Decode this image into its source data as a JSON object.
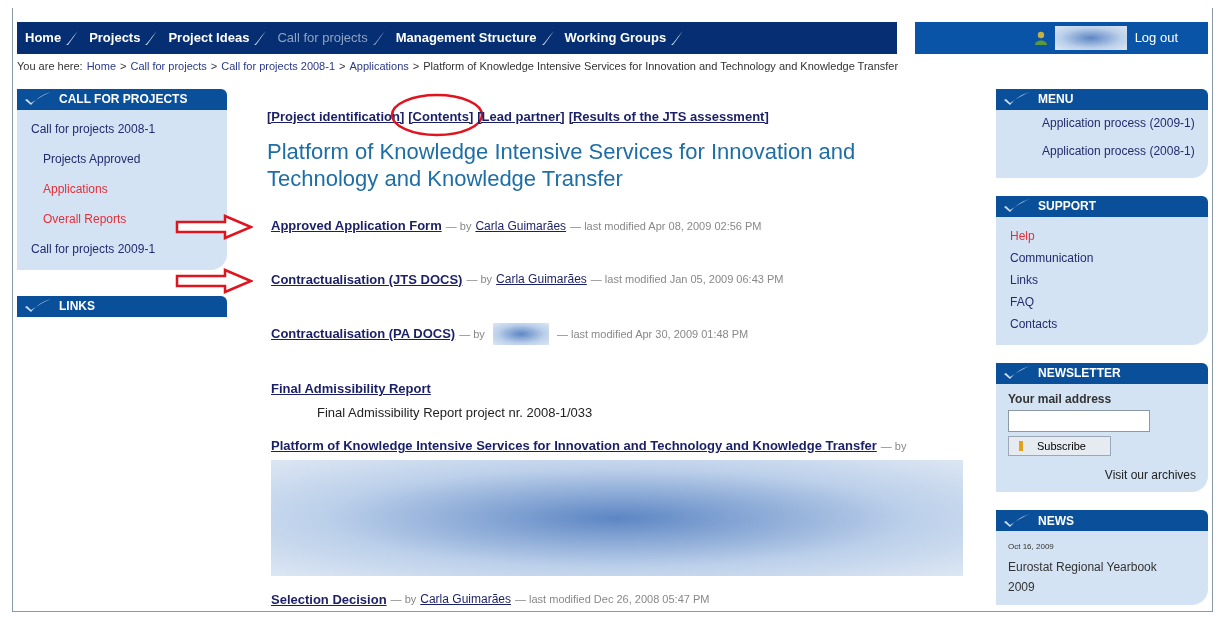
{
  "nav": {
    "items": [
      {
        "label": "Home",
        "selected": false
      },
      {
        "label": "Projects",
        "selected": false
      },
      {
        "label": "Project Ideas",
        "selected": false
      },
      {
        "label": "Call for projects",
        "selected": true
      },
      {
        "label": "Management Structure",
        "selected": false
      },
      {
        "label": "Working Groups",
        "selected": false
      }
    ],
    "logout": "Log out"
  },
  "breadcrumb": [
    {
      "kind": "text",
      "label": "You are here:"
    },
    {
      "kind": "link",
      "label": "Home"
    },
    {
      "kind": "separator",
      "label": ">"
    },
    {
      "kind": "link",
      "label": "Call for projects"
    },
    {
      "kind": "separator",
      "label": ">"
    },
    {
      "kind": "link",
      "label": "Call for projects 2008-1"
    },
    {
      "kind": "separator",
      "label": ">"
    },
    {
      "kind": "link",
      "label": "Applications"
    },
    {
      "kind": "separator",
      "label": ">"
    },
    {
      "kind": "text",
      "label": "Platform of Knowledge Intensive Services for Innovation and Technology and Knowledge Transfer"
    }
  ],
  "left_sidebar": [
    {
      "title": "CALL FOR PROJECTS",
      "items": [
        {
          "label": "Call for projects 2008-1",
          "selected": false,
          "children": [
            {
              "label": "Projects Approved",
              "selected": false
            },
            {
              "label": "Applications",
              "selected": true
            },
            {
              "label": "Overall Reports",
              "selected": true
            }
          ]
        },
        {
          "label": "Call for projects 2009-1",
          "selected": false
        }
      ]
    },
    {
      "title": "LINKS"
    }
  ],
  "tabs": [
    {
      "label": "[Project identification]",
      "circled": false
    },
    {
      "label": "[Contents]",
      "circled": true
    },
    {
      "label": "[Lead partner]",
      "circled": false
    },
    {
      "label": "[Results of the JTS assessment]",
      "circled": false
    }
  ],
  "heading": "Platform of Knowledge Intensive Services for Innovation and Technology and Knowledge Transfer",
  "documents": [
    {
      "kind": "meta",
      "title": "Approved Application Form",
      "by": "— by",
      "author": "Carla Guimarães",
      "modified": "— last modified Apr 08, 2009 02:56 PM",
      "arrow": true
    },
    {
      "kind": "meta",
      "title": "Contractualisation (JTS DOCS)",
      "by": "— by",
      "author": "Carla Guimarães",
      "modified": "— last modified Jan 05, 2009 06:43 PM",
      "arrow": true
    },
    {
      "kind": "redacted_author",
      "title": "Contractualisation (PA DOCS)",
      "by": "— by",
      "modified": "— last modified Apr 30, 2009 01:48 PM",
      "arrow": false
    },
    {
      "kind": "description",
      "title": "Final Admissibility Report",
      "description": "Final Admissibility Report project nr. 2008-1/033",
      "arrow": false
    },
    {
      "kind": "redacted_block",
      "title": "Platform of Knowledge Intensive Services for Innovation and Technology and Knowledge Transfer",
      "by": "— by",
      "arrow": false
    },
    {
      "kind": "meta",
      "title": "Selection Decision",
      "by": "— by",
      "author": "Carla Guimarães",
      "modified": "— last modified Dec 26, 2008 05:47 PM",
      "arrow": false
    }
  ],
  "right_sidebar": [
    {
      "kind": "links",
      "title": "MENU",
      "indent": true,
      "items": [
        {
          "label": "Application process (2009-1)",
          "selected": false
        },
        {
          "label": "Application process (2008-1)",
          "selected": false
        }
      ]
    },
    {
      "kind": "links",
      "title": "SUPPORT",
      "indent": false,
      "items": [
        {
          "label": "Help",
          "selected": true
        },
        {
          "label": "Communication",
          "selected": false
        },
        {
          "label": "Links",
          "selected": false
        },
        {
          "label": "FAQ",
          "selected": false
        },
        {
          "label": "Contacts",
          "selected": false
        }
      ]
    },
    {
      "kind": "newsletter",
      "title": "NEWSLETTER",
      "label": "Your mail address",
      "button": "Subscribe",
      "archives": "Visit our archives"
    },
    {
      "kind": "news",
      "title": "NEWS",
      "date": "Oct 16, 2009",
      "headline": "Eurostat Regional Yearbook 2009"
    }
  ]
}
